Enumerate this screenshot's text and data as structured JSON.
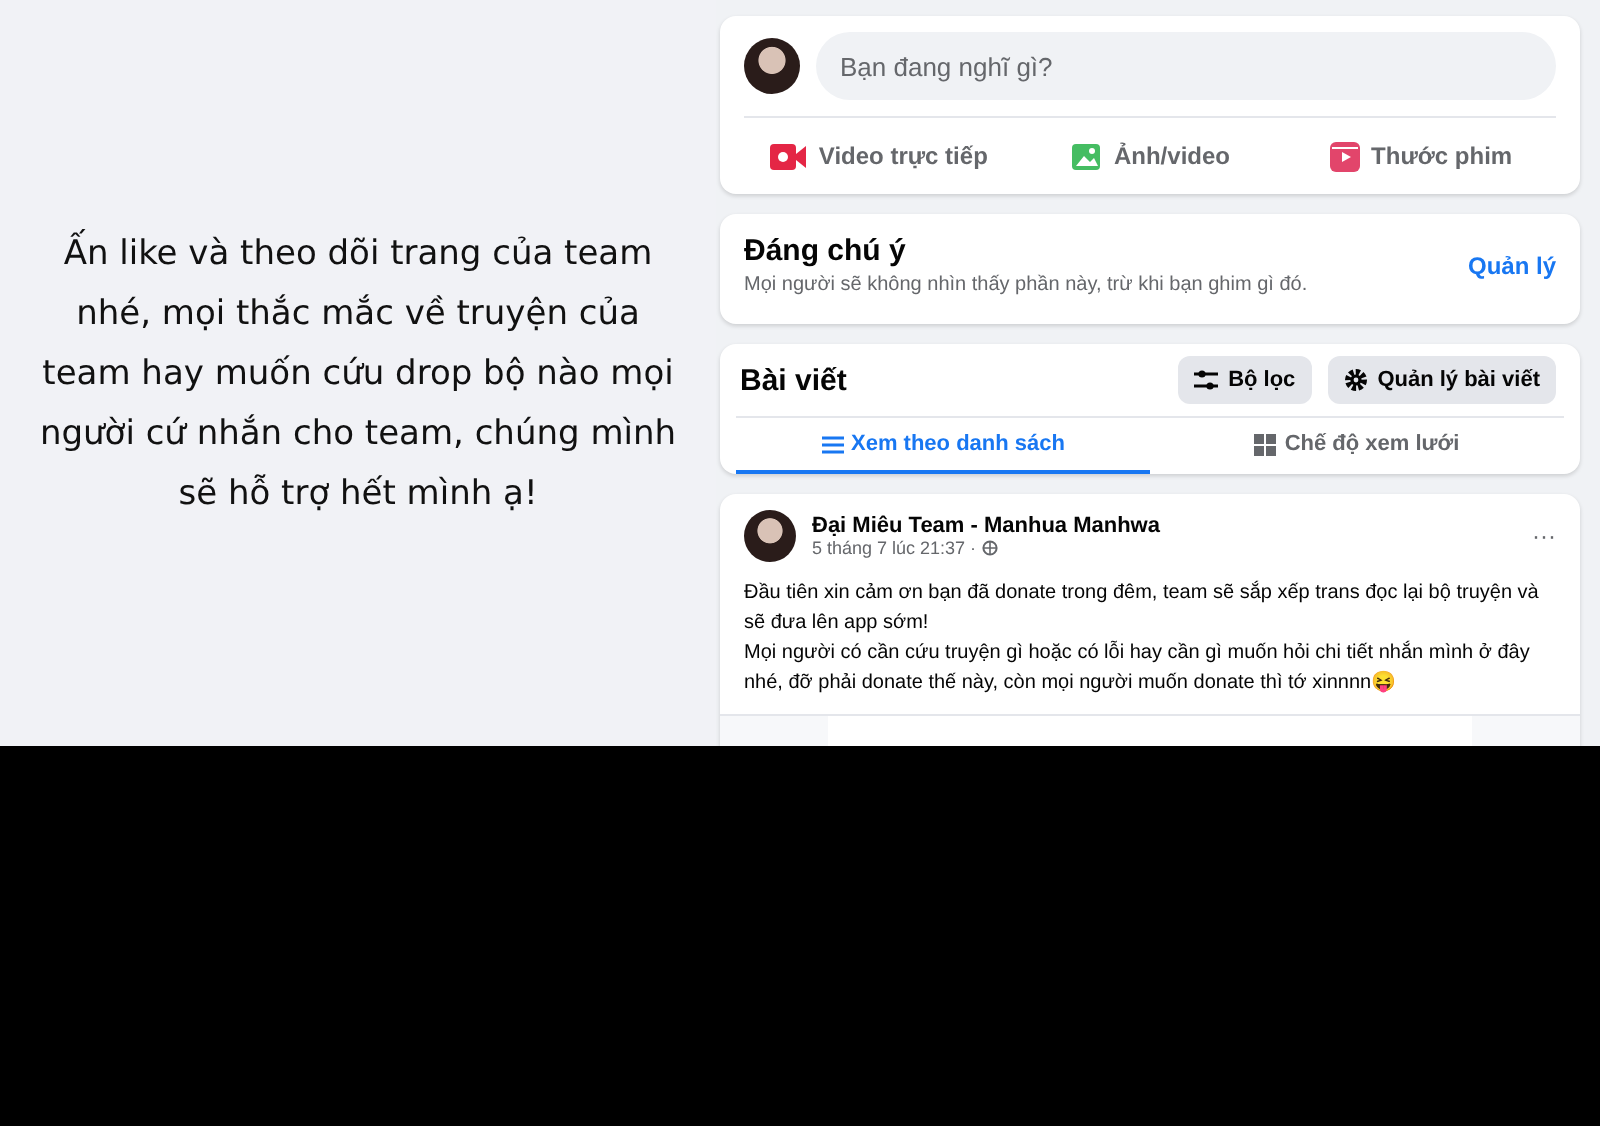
{
  "promo": {
    "text": "Ấn like và theo dõi trang của team nhé, mọi thắc mắc về truyện của team hay muốn cứu drop bộ nào mọi người cứ nhắn cho team, chúng mình sẽ hỗ trợ hết mình ạ!"
  },
  "composer": {
    "placeholder": "Bạn đang nghĩ gì?",
    "actions": [
      {
        "kind": "live",
        "label": "Video trực tiếp"
      },
      {
        "kind": "photo",
        "label": "Ảnh/video"
      },
      {
        "kind": "reel",
        "label": "Thước phim"
      }
    ]
  },
  "featured": {
    "title": "Đáng chú ý",
    "subtitle": "Mọi người sẽ không nhìn thấy phần này, trừ khi bạn ghim gì đó.",
    "link": "Quản lý"
  },
  "posts": {
    "title": "Bài viết",
    "buttons": [
      {
        "kind": "filter",
        "label": "Bộ lọc"
      },
      {
        "kind": "manage",
        "label": "Quản lý bài viết"
      }
    ],
    "tabs": [
      {
        "kind": "list",
        "label": "Xem theo danh sách",
        "selected": true
      },
      {
        "kind": "grid",
        "label": "Chế độ xem lưới",
        "selected": false
      }
    ]
  },
  "post": {
    "author": "Đại Miêu Team - Manhua Manhwa",
    "time": "5 tháng 7 lúc 21:37 ·",
    "menu": "···",
    "lines": [
      "Đầu tiên xin cảm ơn bạn đã donate trong đêm, team sẽ sắp xếp trans đọc lại bộ truyện và sẽ đưa lên app sớm!",
      "Mọi người có cần cứu truyện gì hoặc có lỗi hay cần gì muốn hỏi chi tiết nhắn mình ở đây nhé, đỡ phải donate thế này, còn mọi người muốn donate thì tớ xinnnn😝"
    ]
  }
}
